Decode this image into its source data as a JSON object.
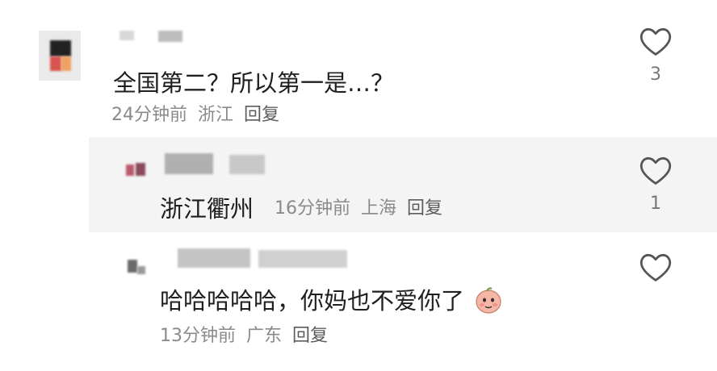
{
  "comments": [
    {
      "text": "全国第二？所以第一是…？",
      "time": "24分钟前",
      "location": "浙江",
      "reply": "回复",
      "likes": "3"
    },
    {
      "text": "浙江衢州",
      "time": "16分钟前",
      "location": "上海",
      "reply": "回复",
      "likes": "1"
    },
    {
      "text": "哈哈哈哈哈，你妈也不爱你了",
      "time": "13分钟前",
      "location": "广东",
      "reply": "回复",
      "likes": ""
    }
  ],
  "icons": {
    "like": "heart-outline-icon",
    "emoji": "peach-face-emoji-icon"
  },
  "colors": {
    "text": "#1f1f1f",
    "meta": "#8a8a8a",
    "reply_bg": "#f4f4f4",
    "icon": "#555555"
  }
}
